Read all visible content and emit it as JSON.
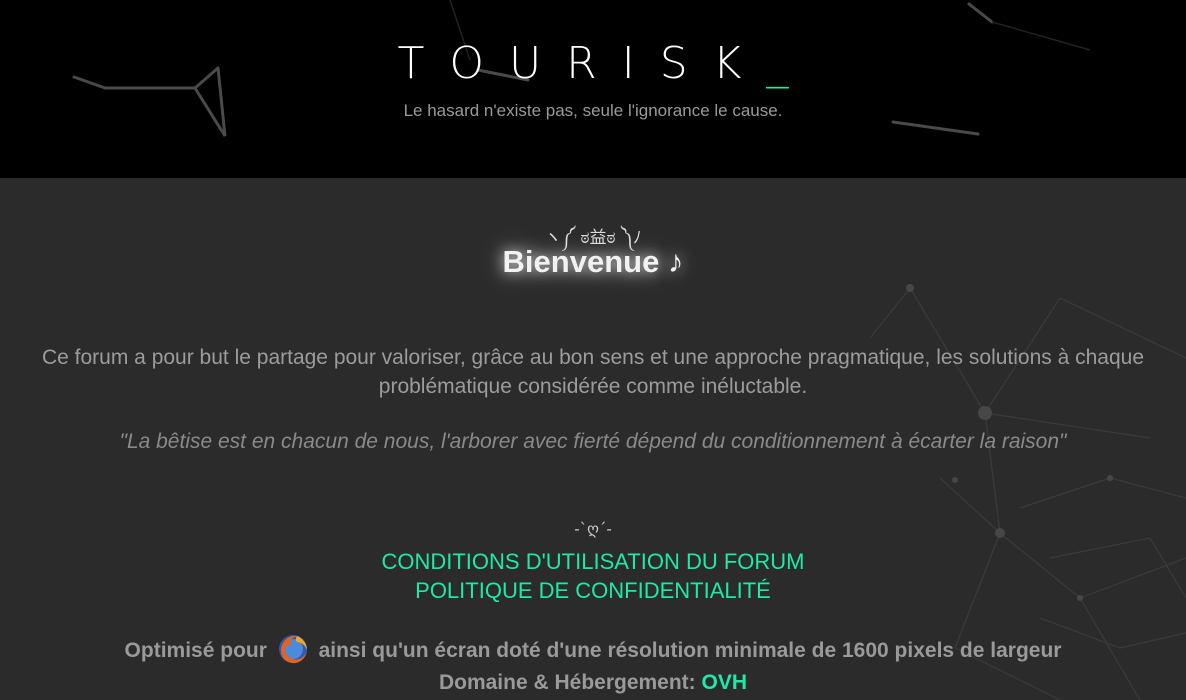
{
  "header": {
    "logo_text": "TOURISK",
    "logo_cursor": "_",
    "tagline": "Le hasard n'existe pas, seule l'ignorance le cause."
  },
  "welcome": {
    "kaomoji": "ヽ༼ ಠ益ಠ ༽ﾉ",
    "title": "Bienvenue ♪"
  },
  "content": {
    "description": "Ce forum a pour but le partage pour valoriser, grâce au bon sens et une approche pragmatique, les solutions à chaque problématique considérée comme inéluctable.",
    "quote": "\"La bêtise est en chacun de nous, l'arborer avec fierté dépend du conditionnement à écarter la raison\"",
    "heart_symbol": "-`ღ´-"
  },
  "links": {
    "cgu": "CONDITIONS D'UTILISATION DU FORUM",
    "privacy": "POLITIQUE DE CONFIDENTIALITÉ"
  },
  "footer": {
    "optimized_prefix": "Optimisé pour",
    "browser_icon": "firefox-icon",
    "optimized_suffix": "ainsi qu'un écran doté d'une résolution minimale de 1600 pixels de largeur",
    "hosting_prefix": "Domaine & Hébergement:",
    "hosting_provider": "OVH"
  },
  "colors": {
    "accent": "#1de9a8",
    "header_bg": "#000000",
    "body_bg": "#2b2b2b",
    "text_muted": "#9a9a9a"
  }
}
